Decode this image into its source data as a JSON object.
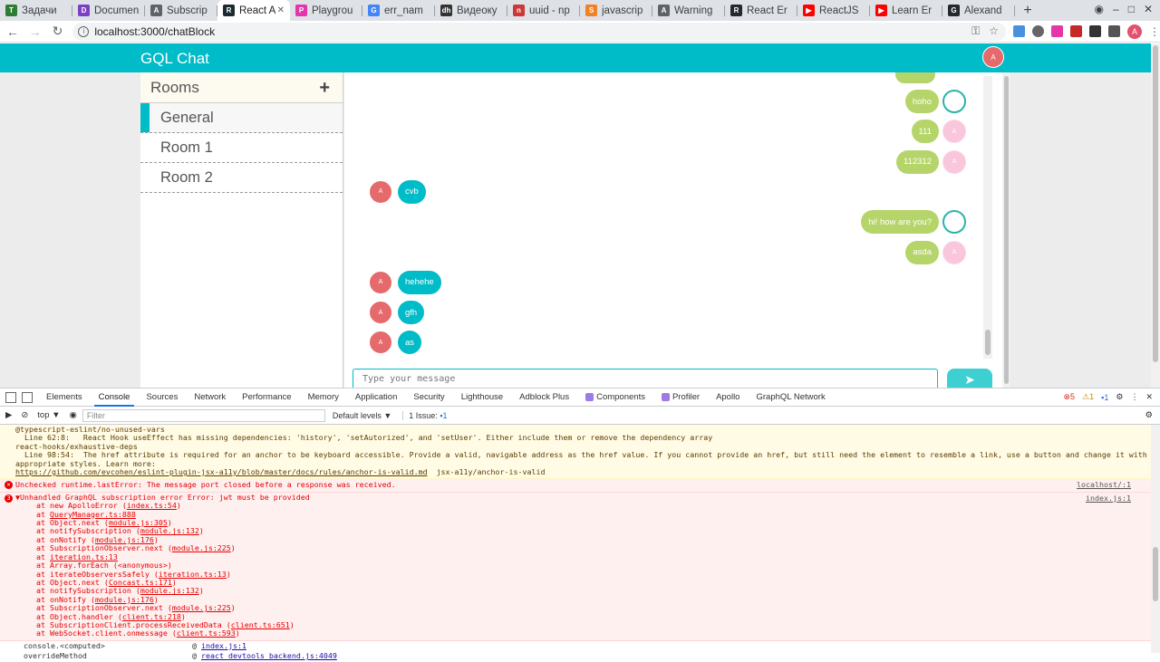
{
  "browser": {
    "tabs": [
      {
        "title": "Задачи",
        "color": "#2e7d32",
        "glyph": "T",
        "active": false
      },
      {
        "title": "Documen",
        "color": "#7b3fc4",
        "glyph": "D",
        "active": false
      },
      {
        "title": "Subscrip",
        "color": "#5f6368",
        "glyph": "A",
        "active": false
      },
      {
        "title": "React Ap",
        "color": "#1b2a33",
        "glyph": "R",
        "active": true
      },
      {
        "title": "Playgrou",
        "color": "#e535ab",
        "glyph": "P",
        "active": false
      },
      {
        "title": "err_nam",
        "color": "#4285f4",
        "glyph": "G",
        "active": false
      },
      {
        "title": "Видеоку",
        "color": "#333333",
        "glyph": "dh",
        "active": false
      },
      {
        "title": "uuid - np",
        "color": "#cb3837",
        "glyph": "n",
        "active": false
      },
      {
        "title": "javascrip",
        "color": "#f48024",
        "glyph": "S",
        "active": false
      },
      {
        "title": "Warning",
        "color": "#5f6368",
        "glyph": "A",
        "active": false
      },
      {
        "title": "React Er",
        "color": "#24292e",
        "glyph": "R",
        "active": false
      },
      {
        "title": "ReactJS",
        "color": "#ff0000",
        "glyph": "▶",
        "active": false
      },
      {
        "title": "Learn Er",
        "color": "#ff0000",
        "glyph": "▶",
        "active": false
      },
      {
        "title": "Alexand",
        "color": "#24292e",
        "glyph": "G",
        "active": false
      }
    ],
    "url": "localhost:3000/chatBlock",
    "profile_initial": "A"
  },
  "app": {
    "title": "GQL Chat",
    "user_avatar": "A",
    "rooms_title": "Rooms",
    "add_room_glyph": "+",
    "rooms": [
      {
        "name": "General",
        "active": true
      },
      {
        "name": "Room 1",
        "active": false
      },
      {
        "name": "Room 2",
        "active": false
      }
    ],
    "messages": [
      {
        "text": "hoho",
        "own": true,
        "avatar": "glasses",
        "avatar_text": ""
      },
      {
        "text": "111",
        "own": true,
        "avatar": "pink",
        "avatar_text": "A"
      },
      {
        "text": "112312",
        "own": true,
        "avatar": "pink",
        "avatar_text": "A"
      },
      {
        "text": "cvb",
        "own": false,
        "avatar": "red",
        "avatar_text": "A"
      },
      {
        "text": "hi! how are you?",
        "own": true,
        "avatar": "glasses",
        "avatar_text": ""
      },
      {
        "text": "asda",
        "own": true,
        "avatar": "pink",
        "avatar_text": "A"
      },
      {
        "text": "hehehe",
        "own": false,
        "avatar": "red",
        "avatar_text": "A"
      },
      {
        "text": "gfh",
        "own": false,
        "avatar": "red",
        "avatar_text": "A"
      },
      {
        "text": "as",
        "own": false,
        "avatar": "red",
        "avatar_text": "A"
      }
    ],
    "input_placeholder": "Type your message"
  },
  "devtools": {
    "tabs": [
      "Elements",
      "Console",
      "Sources",
      "Network",
      "Performance",
      "Memory",
      "Application",
      "Security",
      "Lighthouse",
      "Adblock Plus",
      "Components",
      "Profiler",
      "Apollo",
      "GraphQL Network"
    ],
    "active_tab": "Console",
    "error_count": "5",
    "warning_count": "1",
    "info_count": "1",
    "context": "top ▼",
    "filter_placeholder": "Filter",
    "levels": "Default levels ▼",
    "issues": "1 Issue:",
    "issues_count": "1",
    "warnings": [
      "@typescript-eslint/no-unused-vars",
      "  Line 62:8:   React Hook useEffect has missing dependencies: 'history', 'setAutorized', and 'setUser'. Either include them or remove the dependency array",
      "react-hooks/exhaustive-deps",
      "  Line 98:54:  The href attribute is required for an anchor to be keyboard accessible. Provide a valid, navigable address as the href value. If you cannot provide an href, but still need the element to resemble a link, use a button and change it with",
      "appropriate styles. Learn more:"
    ],
    "warn_link": "https://github.com/evcohen/eslint-plugin-jsx-a11y/blob/master/docs/rules/anchor-is-valid.md",
    "warn_rule": "jsx-a11y/anchor-is-valid",
    "runtime_error": "Unchecked runtime.lastError: The message port closed before a response was received.",
    "runtime_error_src": "localhost/:1",
    "gql_error_count": "3",
    "gql_error": "▼Unhandled GraphQL subscription error Error: jwt must be provided",
    "gql_error_src": "index.js:1",
    "stack": [
      {
        "fn": "at new ApolloError (",
        "file": "index.ts:54",
        "end": ")"
      },
      {
        "fn": "at ",
        "file": "QueryManager.ts:888",
        "end": ""
      },
      {
        "fn": "at Object.next (",
        "file": "module.js:305",
        "end": ")"
      },
      {
        "fn": "at notifySubscription (",
        "file": "module.js:132",
        "end": ")"
      },
      {
        "fn": "at onNotify (",
        "file": "module.js:176",
        "end": ")"
      },
      {
        "fn": "at SubscriptionObserver.next (",
        "file": "module.js:225",
        "end": ")"
      },
      {
        "fn": "at ",
        "file": "iteration.ts:13",
        "end": ""
      },
      {
        "fn": "at Array.forEach (<anonymous>)",
        "file": "",
        "end": ""
      },
      {
        "fn": "at iterateObserversSafely (",
        "file": "iteration.ts:13",
        "end": ")"
      },
      {
        "fn": "at Object.next (",
        "file": "Concast.ts:171",
        "end": ")"
      },
      {
        "fn": "at notifySubscription (",
        "file": "module.js:132",
        "end": ")"
      },
      {
        "fn": "at onNotify (",
        "file": "module.js:176",
        "end": ")"
      },
      {
        "fn": "at SubscriptionObserver.next (",
        "file": "module.js:225",
        "end": ")"
      },
      {
        "fn": "at Object.handler (",
        "file": "client.ts:218",
        "end": ")"
      },
      {
        "fn": "at SubscriptionClient.processReceivedData (",
        "file": "client.ts:651",
        "end": ")"
      },
      {
        "fn": "at WebSocket.client.onmessage (",
        "file": "client.ts:593",
        "end": ")"
      }
    ],
    "tail": [
      {
        "label": "console.<computed>",
        "file": "index.js:1"
      },
      {
        "label": "overrideMethod",
        "file": "react_devtools_backend.js:4049"
      }
    ]
  }
}
